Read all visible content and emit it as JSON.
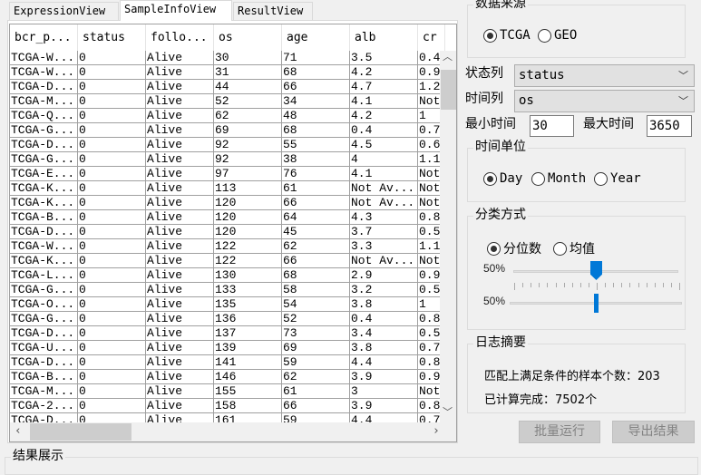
{
  "tabs": [
    {
      "label": "ExpressionView"
    },
    {
      "label": "SampleInfoView"
    },
    {
      "label": "ResultView"
    }
  ],
  "table": {
    "columns": [
      "bcr_p...",
      "status",
      "follo...",
      "os",
      "age",
      "alb",
      "cr"
    ],
    "rows": [
      [
        "TCGA-W...",
        "0",
        "Alive",
        "30",
        "71",
        "3.5",
        "0.4"
      ],
      [
        "TCGA-W...",
        "0",
        "Alive",
        "31",
        "68",
        "4.2",
        "0.9"
      ],
      [
        "TCGA-D...",
        "0",
        "Alive",
        "44",
        "66",
        "4.7",
        "1.2"
      ],
      [
        "TCGA-M...",
        "0",
        "Alive",
        "52",
        "34",
        "4.1",
        "Not"
      ],
      [
        "TCGA-Q...",
        "0",
        "Alive",
        "62",
        "48",
        "4.2",
        "1"
      ],
      [
        "TCGA-G...",
        "0",
        "Alive",
        "69",
        "68",
        "0.4",
        "0.7"
      ],
      [
        "TCGA-D...",
        "0",
        "Alive",
        "92",
        "55",
        "4.5",
        "0.6"
      ],
      [
        "TCGA-G...",
        "0",
        "Alive",
        "92",
        "38",
        "4",
        "1.1"
      ],
      [
        "TCGA-E...",
        "0",
        "Alive",
        "97",
        "76",
        "4.1",
        "Not"
      ],
      [
        "TCGA-K...",
        "0",
        "Alive",
        "113",
        "61",
        "Not Av...",
        "Not"
      ],
      [
        "TCGA-K...",
        "0",
        "Alive",
        "120",
        "66",
        "Not Av...",
        "Not"
      ],
      [
        "TCGA-B...",
        "0",
        "Alive",
        "120",
        "64",
        "4.3",
        "0.8"
      ],
      [
        "TCGA-D...",
        "0",
        "Alive",
        "120",
        "45",
        "3.7",
        "0.5"
      ],
      [
        "TCGA-W...",
        "0",
        "Alive",
        "122",
        "62",
        "3.3",
        "1.1"
      ],
      [
        "TCGA-K...",
        "0",
        "Alive",
        "122",
        "66",
        "Not Av...",
        "Not"
      ],
      [
        "TCGA-L...",
        "0",
        "Alive",
        "130",
        "68",
        "2.9",
        "0.9"
      ],
      [
        "TCGA-G...",
        "0",
        "Alive",
        "133",
        "58",
        "3.2",
        "0.5"
      ],
      [
        "TCGA-O...",
        "0",
        "Alive",
        "135",
        "54",
        "3.8",
        "1"
      ],
      [
        "TCGA-G...",
        "0",
        "Alive",
        "136",
        "52",
        "0.4",
        "0.8"
      ],
      [
        "TCGA-D...",
        "0",
        "Alive",
        "137",
        "73",
        "3.4",
        "0.5"
      ],
      [
        "TCGA-U...",
        "0",
        "Alive",
        "139",
        "69",
        "3.8",
        "0.7"
      ],
      [
        "TCGA-D...",
        "0",
        "Alive",
        "141",
        "59",
        "4.4",
        "0.8"
      ],
      [
        "TCGA-B...",
        "0",
        "Alive",
        "146",
        "62",
        "3.9",
        "0.9"
      ],
      [
        "TCGA-M...",
        "0",
        "Alive",
        "155",
        "61",
        "3",
        "Not"
      ],
      [
        "TCGA-2...",
        "0",
        "Alive",
        "158",
        "66",
        "3.9",
        "0.8"
      ],
      [
        "TCGA-D...",
        "0",
        "Alive",
        "161",
        "59",
        "4.4",
        "0.7"
      ]
    ]
  },
  "datasource": {
    "title": "数据来源",
    "options": [
      "TCGA",
      "GEO"
    ],
    "selected": "TCGA"
  },
  "status_col": {
    "label": "状态列",
    "value": "status"
  },
  "time_col": {
    "label": "时间列",
    "value": "os"
  },
  "min_time": {
    "label": "最小时间",
    "value": "30"
  },
  "max_time": {
    "label": "最大时间",
    "value": "3650"
  },
  "time_unit": {
    "title": "时间单位",
    "options": [
      "Day",
      "Month",
      "Year"
    ],
    "selected": "Day"
  },
  "classify": {
    "title": "分类方式",
    "options": [
      "分位数",
      "均值"
    ],
    "selected": "分位数",
    "slider1_label": "50%",
    "slider1_value": 50,
    "slider2_label": "50%",
    "slider2_value": 50,
    "accent": "#0078d7"
  },
  "log": {
    "title": "日志摘要",
    "line1": "匹配上满足条件的样本个数：203",
    "line2": "已计算完成：7502个"
  },
  "buttons": {
    "batch_run": "批量运行",
    "export": "导出结果"
  },
  "result": {
    "title": "结果展示"
  }
}
